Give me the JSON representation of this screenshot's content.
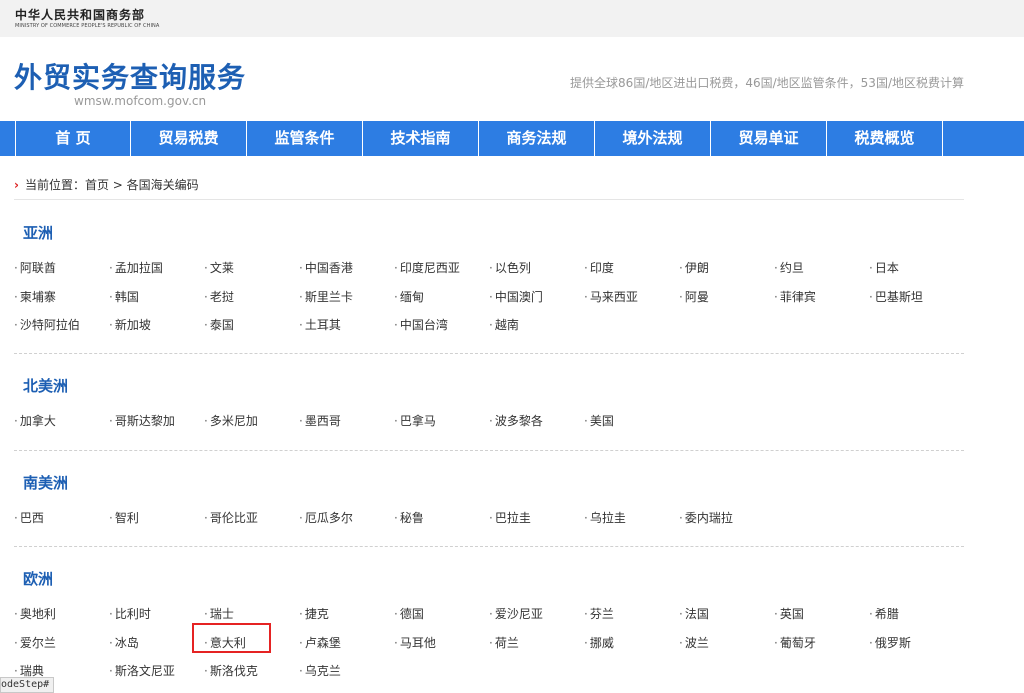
{
  "header": {
    "ministry_cn": "中华人民共和国商务部",
    "ministry_en": "MINISTRY OF COMMERCE PEOPLE'S REPUBLIC OF CHINA",
    "site_title": "外贸实务查询服务",
    "site_url": "wmsw.mofcom.gov.cn",
    "site_desc": "提供全球86国/地区进出口税费，46国/地区监管条件，53国/地区税费计算"
  },
  "nav": {
    "items": [
      "首 页",
      "贸易税费",
      "监管条件",
      "技术指南",
      "商务法规",
      "境外法规",
      "贸易单证",
      "税费概览"
    ]
  },
  "breadcrumb": {
    "chevron": "›",
    "label": "当前位置：",
    "home": "首页",
    "sep": " > ",
    "current": "各国海关编码"
  },
  "regions": [
    {
      "title": "亚洲",
      "countries": [
        "阿联酋",
        "孟加拉国",
        "文莱",
        "中国香港",
        "印度尼西亚",
        "以色列",
        "印度",
        "伊朗",
        "约旦",
        "日本",
        "柬埔寨",
        "韩国",
        "老挝",
        "斯里兰卡",
        "缅甸",
        "中国澳门",
        "马来西亚",
        "阿曼",
        "菲律宾",
        "巴基斯坦",
        "沙特阿拉伯",
        "新加坡",
        "泰国",
        "土耳其",
        "中国台湾",
        "越南"
      ]
    },
    {
      "title": "北美洲",
      "countries": [
        "加拿大",
        "哥斯达黎加",
        "多米尼加",
        "墨西哥",
        "巴拿马",
        "波多黎各",
        "美国"
      ]
    },
    {
      "title": "南美洲",
      "countries": [
        "巴西",
        "智利",
        "哥伦比亚",
        "厄瓜多尔",
        "秘鲁",
        "巴拉圭",
        "乌拉圭",
        "委内瑞拉"
      ]
    },
    {
      "title": "欧洲",
      "countries": [
        "奥地利",
        "比利时",
        "瑞士",
        "捷克",
        "德国",
        "爱沙尼亚",
        "芬兰",
        "法国",
        "英国",
        "希腊",
        "爱尔兰",
        "冰岛",
        "意大利",
        "卢森堡",
        "马耳他",
        "荷兰",
        "挪威",
        "波兰",
        "葡萄牙",
        "俄罗斯",
        "瑞典",
        "斯洛文尼亚",
        "斯洛伐克",
        "乌克兰"
      ]
    }
  ],
  "status_tag": "odeStep#"
}
